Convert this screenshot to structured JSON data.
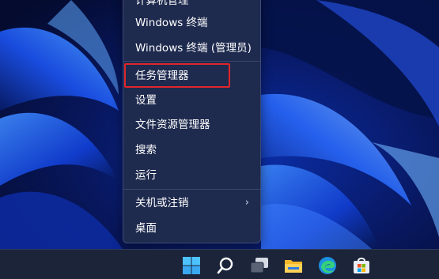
{
  "menu": {
    "items": [
      {
        "label": "计算机管理"
      },
      {
        "label": "Windows 终端"
      },
      {
        "label": "Windows 终端 (管理员)"
      },
      {
        "label": "任务管理器"
      },
      {
        "label": "设置"
      },
      {
        "label": "文件资源管理器"
      },
      {
        "label": "搜索"
      },
      {
        "label": "运行"
      },
      {
        "label": "关机或注销",
        "has_submenu": true
      },
      {
        "label": "桌面"
      }
    ],
    "highlighted_item": "任务管理器",
    "highlight_color": "#e0262a"
  },
  "taskbar": {
    "icons": [
      "windows-start-icon",
      "search-icon",
      "task-view-icon",
      "file-explorer-icon",
      "edge-browser-icon",
      "microsoft-store-icon"
    ]
  },
  "colors": {
    "menu_background": "#1e2a4e",
    "taskbar_background": "#1b2439",
    "wallpaper_accent": "#1f5fff"
  }
}
